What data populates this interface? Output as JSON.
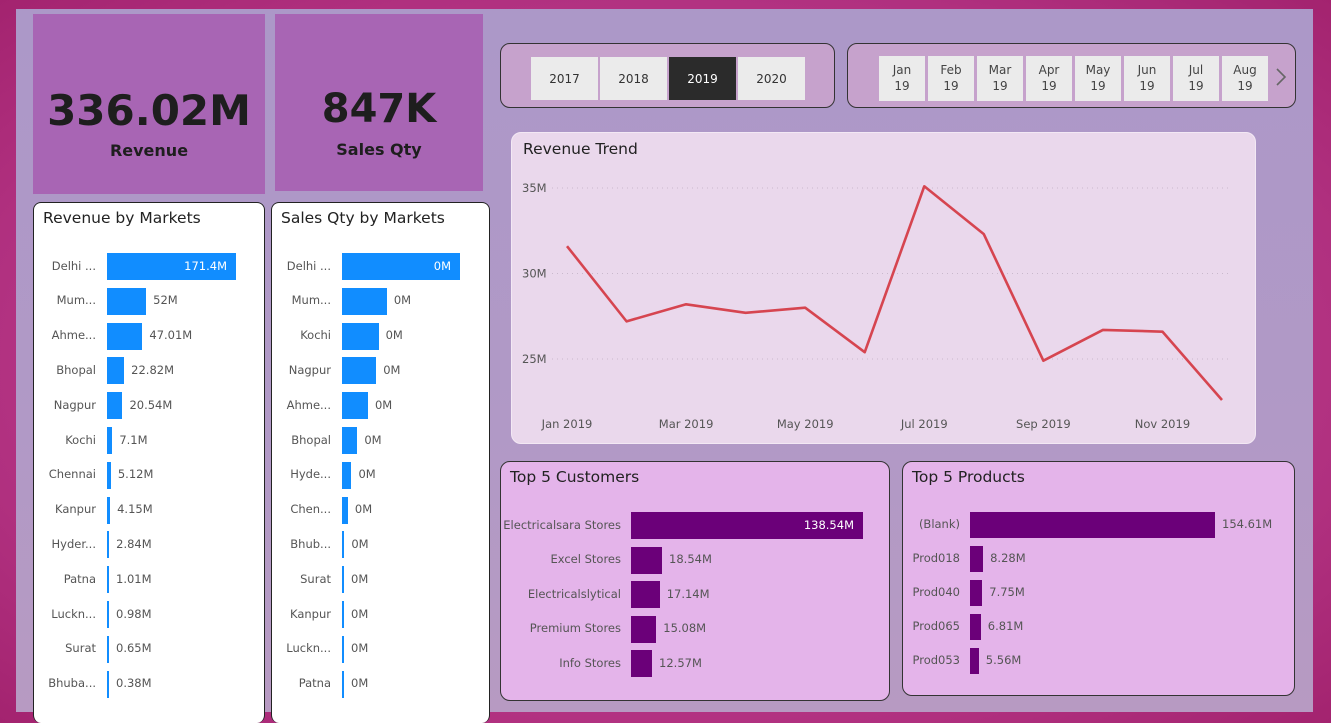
{
  "kpis": [
    {
      "value": "336.02M",
      "label": "Revenue"
    },
    {
      "value": "847K",
      "label": "Sales Qty"
    }
  ],
  "year_slicer": {
    "years": [
      "2017",
      "2018",
      "2019",
      "2020"
    ],
    "selected": "2019"
  },
  "month_slicer": {
    "months": [
      {
        "m": "Jan",
        "y": "19"
      },
      {
        "m": "Feb",
        "y": "19"
      },
      {
        "m": "Mar",
        "y": "19"
      },
      {
        "m": "Apr",
        "y": "19"
      },
      {
        "m": "May",
        "y": "19"
      },
      {
        "m": "Jun",
        "y": "19"
      },
      {
        "m": "Jul",
        "y": "19"
      },
      {
        "m": "Aug",
        "y": "19"
      }
    ],
    "next_icon": "chevron-right-icon"
  },
  "colors": {
    "market_bar": "#118dff",
    "top5_bar": "#6b0079",
    "trend_line": "#d64550",
    "selected_year": "#2b2b2b"
  },
  "chart_data": [
    {
      "type": "bar",
      "title": "Revenue by Markets",
      "categories": [
        "Delhi ...",
        "Mum...",
        "Ahme...",
        "Bhopal",
        "Nagpur",
        "Kochi",
        "Chennai",
        "Kanpur",
        "Hyder...",
        "Patna",
        "Luckn...",
        "Surat",
        "Bhuba..."
      ],
      "values": [
        171.4,
        52,
        47.01,
        22.82,
        20.54,
        7.1,
        5.12,
        4.15,
        2.84,
        1.01,
        0.98,
        0.65,
        0.38
      ],
      "labels": [
        "171.4M",
        "52M",
        "47.01M",
        "22.82M",
        "20.54M",
        "7.1M",
        "5.12M",
        "4.15M",
        "2.84M",
        "1.01M",
        "0.98M",
        "0.65M",
        "0.38M"
      ]
    },
    {
      "type": "bar",
      "title": "Sales Qty by Markets",
      "categories": [
        "Delhi ...",
        "Mum...",
        "Kochi",
        "Nagpur",
        "Ahme...",
        "Bhopal",
        "Hyde...",
        "Chen...",
        "Bhub...",
        "Surat",
        "Kanpur",
        "Luckn...",
        "Patna"
      ],
      "values": [
        100,
        38,
        31,
        29,
        22,
        13,
        8,
        5,
        2,
        1.5,
        1,
        0.8,
        0.6
      ],
      "labels": [
        "0M",
        "0M",
        "0M",
        "0M",
        "0M",
        "0M",
        "0M",
        "0M",
        "0M",
        "0M",
        "0M",
        "0M",
        "0M"
      ]
    },
    {
      "type": "line",
      "title": "Revenue Trend",
      "x": [
        "Jan 2019",
        "Feb 2019",
        "Mar 2019",
        "Apr 2019",
        "May 2019",
        "Jun 2019",
        "Jul 2019",
        "Aug 2019",
        "Sep 2019",
        "Oct 2019",
        "Nov 2019",
        "Dec 2019"
      ],
      "x_tick_labels": [
        "Jan 2019",
        "Mar 2019",
        "May 2019",
        "Jul 2019",
        "Sep 2019",
        "Nov 2019"
      ],
      "series": [
        {
          "values": [
            31.6,
            27.2,
            28.2,
            27.7,
            28.0,
            25.4,
            35.1,
            32.3,
            24.9,
            26.7,
            26.6,
            22.6
          ]
        }
      ],
      "y_ticks": [
        "35M",
        "30M",
        "25M"
      ],
      "ylim": [
        22,
        36
      ],
      "grid": true
    },
    {
      "type": "bar",
      "title": "Top 5 Customers",
      "categories": [
        "Electricalsara Stores",
        "Excel Stores",
        "Electricalslytical",
        "Premium Stores",
        "Info Stores"
      ],
      "values": [
        138.54,
        18.54,
        17.14,
        15.08,
        12.57
      ],
      "labels": [
        "138.54M",
        "18.54M",
        "17.14M",
        "15.08M",
        "12.57M"
      ]
    },
    {
      "type": "bar",
      "title": "Top 5 Products",
      "categories": [
        "(Blank)",
        "Prod018",
        "Prod040",
        "Prod065",
        "Prod053"
      ],
      "values": [
        154.61,
        8.28,
        7.75,
        6.81,
        5.56
      ],
      "labels": [
        "154.61M",
        "8.28M",
        "7.75M",
        "6.81M",
        "5.56M"
      ]
    }
  ]
}
